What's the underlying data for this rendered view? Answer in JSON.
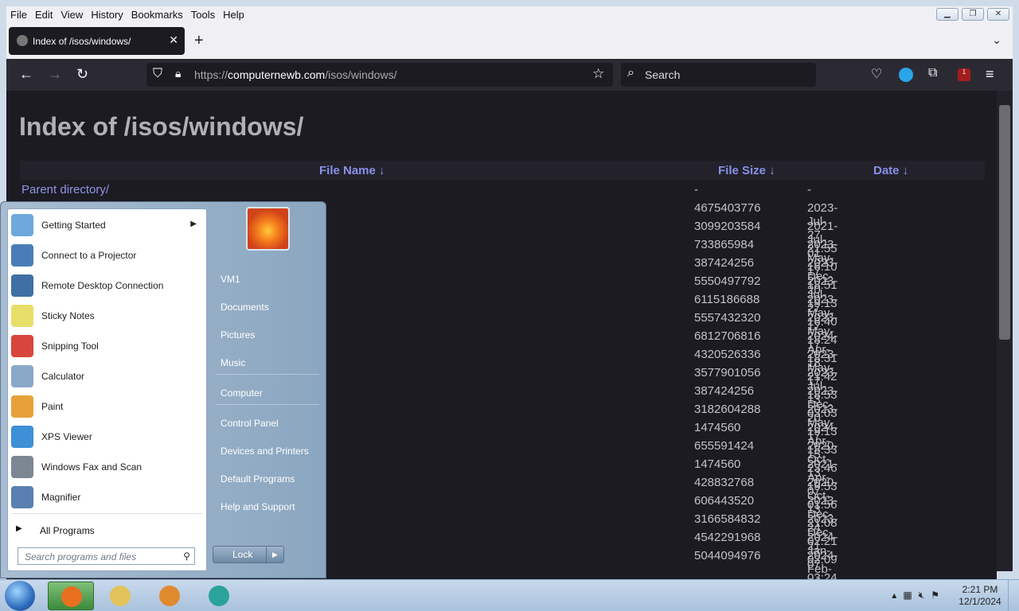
{
  "menubar": {
    "items": [
      "File",
      "Edit",
      "View",
      "History",
      "Bookmarks",
      "Tools",
      "Help"
    ]
  },
  "tab": {
    "title": "Index of /isos/windows/",
    "close": "✕"
  },
  "newtab_label": "+",
  "navbar": {
    "url_scheme": "https://",
    "url_host": "computernewb.com",
    "url_path": "/isos/windows/",
    "search_placeholder": "Search",
    "badge_count": "1"
  },
  "page": {
    "title": "Index of /isos/windows/",
    "col_name": "File Name  ↓",
    "col_size": "File Size  ↓",
    "col_date": "Date  ↓",
    "parent": "Parent directory/"
  },
  "rows": [
    {
      "size": "-",
      "date": "-"
    },
    {
      "size": "4675403776",
      "date": "2023-Jul-27 21:55"
    },
    {
      "size": "3099203584",
      "date": "2021-Jul-01 16:10"
    },
    {
      "size": "733865984",
      "date": "2023-May-17 18:51"
    },
    {
      "size": "387424256",
      "date": "2023-Dec-20 19:13"
    },
    {
      "size": "5550497792",
      "date": "2023-Jul-27 16:40"
    },
    {
      "size": "6115186688",
      "date": "2023-May-17 18:24"
    },
    {
      "size": "5557432320",
      "date": "2023-May-17 18:31"
    },
    {
      "size": "6812706816",
      "date": "2024-Apr-18 21:42"
    },
    {
      "size": "4320526336",
      "date": "2023-May-17 18:53"
    },
    {
      "size": "3577901056",
      "date": "2023-Jul-13 03:03"
    },
    {
      "size": "387424256",
      "date": "2023-Dec-20 19:13"
    },
    {
      "size": "3182604288",
      "date": "2023-May-17 18:33"
    },
    {
      "size": "1474560",
      "date": "2024-Apr-15 23:46"
    },
    {
      "size": "655591424",
      "date": "2020-Oct-13 19:53"
    },
    {
      "size": "1474560",
      "date": "2021-Apr-07 01:56"
    },
    {
      "size": "428832768",
      "date": "2020-Oct-13 21:08"
    },
    {
      "size": "606443520",
      "date": "2023-Dec-24 02:21"
    },
    {
      "size": "3166584832",
      "date": "2023-Dec-21 02:09"
    },
    {
      "size": "4542291968",
      "date": "2024-Jan-07 03:24"
    },
    {
      "size": "5044094976",
      "date": "2024-Feb-26 00:09"
    }
  ],
  "startmenu": {
    "left_items": [
      {
        "label": "Getting Started",
        "icon": "getting-started-icon",
        "color": "#6fa8dc",
        "submenu": true
      },
      {
        "label": "Connect to a Projector",
        "icon": "projector-icon",
        "color": "#4a7db8"
      },
      {
        "label": "Remote Desktop Connection",
        "icon": "remote-desktop-icon",
        "color": "#3f6fa3"
      },
      {
        "label": "Sticky Notes",
        "icon": "sticky-notes-icon",
        "color": "#e8de6a"
      },
      {
        "label": "Snipping Tool",
        "icon": "snipping-tool-icon",
        "color": "#d8453c"
      },
      {
        "label": "Calculator",
        "icon": "calculator-icon",
        "color": "#8aa9c8"
      },
      {
        "label": "Paint",
        "icon": "paint-icon",
        "color": "#e7a13a"
      },
      {
        "label": "XPS Viewer",
        "icon": "xps-viewer-icon",
        "color": "#3d8fd6"
      },
      {
        "label": "Windows Fax and Scan",
        "icon": "fax-scan-icon",
        "color": "#7d8794"
      },
      {
        "label": "Magnifier",
        "icon": "magnifier-icon",
        "color": "#5b7fb0"
      }
    ],
    "all_programs": "All Programs",
    "search_placeholder": "Search programs and files",
    "right_items": [
      "VM1",
      "Documents",
      "Pictures",
      "Music",
      "Computer",
      "Control Panel",
      "Devices and Printers",
      "Default Programs",
      "Help and Support"
    ],
    "lock_label": "Lock"
  },
  "taskbar": {
    "clock_time": "2:21 PM",
    "clock_date": "12/1/2024",
    "apps": [
      {
        "icon": "firefox-icon",
        "color": "#e8701e"
      },
      {
        "icon": "file-explorer-icon",
        "color": "#e2c25a"
      },
      {
        "icon": "media-player-icon",
        "color": "#e08a2e"
      },
      {
        "icon": "app-icon",
        "color": "#2aa39a"
      }
    ]
  }
}
